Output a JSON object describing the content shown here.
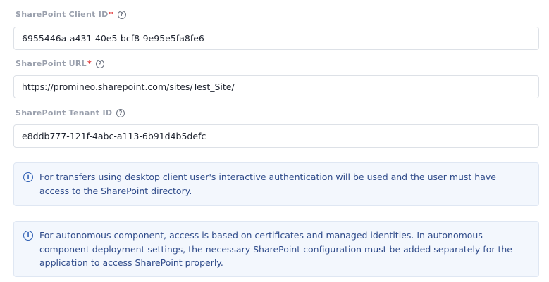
{
  "fields": [
    {
      "label": "SharePoint Client ID",
      "required": "*",
      "help": "?",
      "value": "6955446a-a431-40e5-bcf8-9e95e5fa8fe6"
    },
    {
      "label": "SharePoint URL",
      "required": "*",
      "help": "?",
      "value": "https://promineo.sharepoint.com/sites/Test_Site/"
    },
    {
      "label": "SharePoint Tenant ID",
      "help": "?",
      "value": "e8ddb777-121f-4abc-a113-6b91d4b5defc"
    }
  ],
  "info": [
    {
      "icon": "i",
      "text": "For transfers using desktop client user's interactive authentication will be used and the user must have access to the SharePoint directory."
    },
    {
      "icon": "i",
      "text": "For autonomous component, access is based on certificates and managed identities. In autonomous component deployment settings, the necessary SharePoint configuration must be added separately for the application to access SharePoint properly."
    }
  ],
  "colors": {
    "required": "#e03131",
    "info_text": "#2f4b8a",
    "info_bg": "#f3f7fd"
  }
}
